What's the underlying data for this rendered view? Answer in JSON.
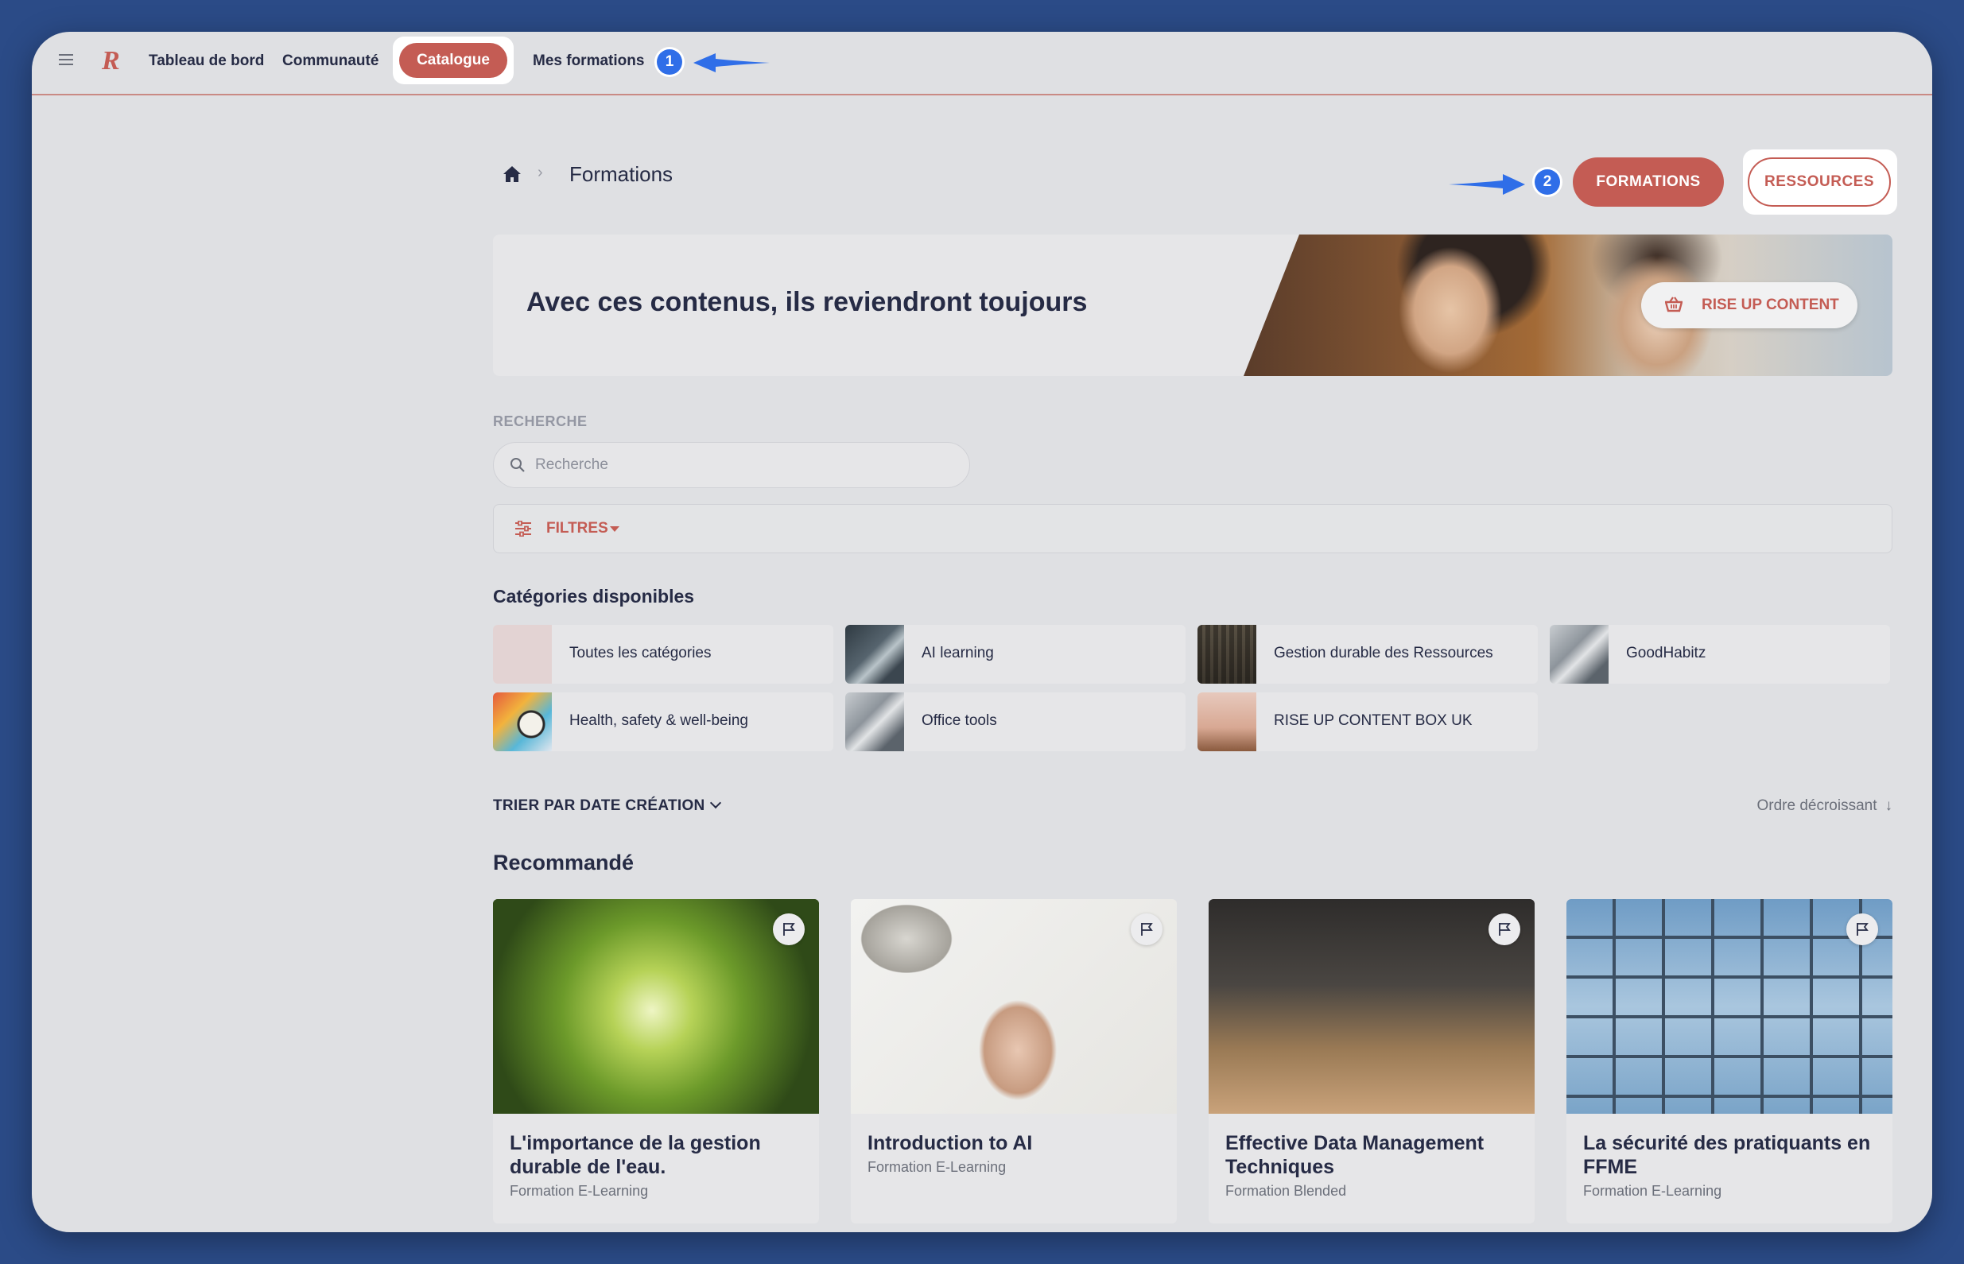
{
  "nav": {
    "items": [
      {
        "label": "Tableau de bord"
      },
      {
        "label": "Communauté"
      },
      {
        "label": "Catalogue"
      },
      {
        "label": "Mes formations"
      }
    ],
    "badge1": "1"
  },
  "breadcrumb": {
    "title": "Formations"
  },
  "header_buttons": {
    "formations": "FORMATIONS",
    "ressources": "RESSOURCES",
    "badge2": "2"
  },
  "banner": {
    "title": "Avec ces contenus, ils reviendront toujours",
    "button": "RISE UP CONTENT"
  },
  "search": {
    "label": "RECHERCHE",
    "placeholder": "Recherche",
    "value": ""
  },
  "filters": {
    "label": "FILTRES"
  },
  "categories": {
    "heading": "Catégories disponibles",
    "items": [
      {
        "label": "Toutes les catégories"
      },
      {
        "label": "AI learning"
      },
      {
        "label": "Gestion durable des Ressources"
      },
      {
        "label": "GoodHabitz"
      },
      {
        "label": "Health, safety & well-being"
      },
      {
        "label": "Office tools"
      },
      {
        "label": "RISE UP CONTENT BOX UK"
      }
    ]
  },
  "sort": {
    "by": "TRIER PAR DATE CRÉATION",
    "order": "Ordre décroissant"
  },
  "recommended": {
    "heading": "Recommandé",
    "courses": [
      {
        "title": "L'importance de la gestion durable de l'eau.",
        "type": "Formation E-Learning"
      },
      {
        "title": "Introduction to AI",
        "type": "Formation E-Learning"
      },
      {
        "title": "Effective Data Management Techniques",
        "type": "Formation Blended"
      },
      {
        "title": "La sécurité des pratiquants en FFME",
        "type": "Formation E-Learning"
      }
    ]
  },
  "colors": {
    "brand": "#c45c54",
    "badge": "#2f6ee8",
    "background": "#2b4b87"
  }
}
